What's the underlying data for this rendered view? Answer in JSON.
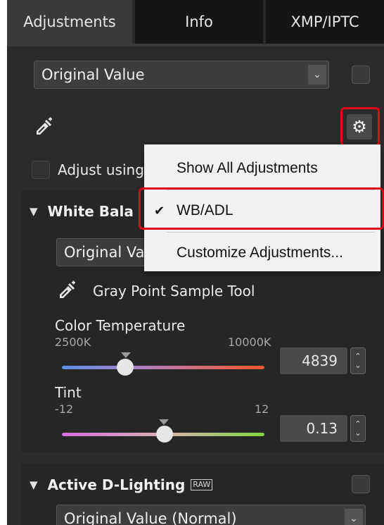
{
  "tabs": [
    {
      "label": "Adjustments",
      "active": true
    },
    {
      "label": "Info",
      "active": false
    },
    {
      "label": "XMP/IPTC",
      "active": false
    }
  ],
  "top": {
    "preset_select": "Original Value",
    "adjust_using_label": "Adjust using"
  },
  "menu": {
    "items": [
      {
        "label": "Show All Adjustments",
        "checked": false
      },
      {
        "label": "WB/ADL",
        "checked": true
      },
      {
        "label": "Customize Adjustments...",
        "checked": false
      }
    ],
    "check_glyph": "✔"
  },
  "white_balance": {
    "title": "White Bala",
    "select": "Original Va",
    "gray_point_tool": "Gray Point Sample Tool",
    "color_temp": {
      "label": "Color Temperature",
      "min_label": "2500K",
      "max_label": "10000K",
      "value": "4839",
      "min": 2500,
      "max": 10000,
      "numeric": 4839
    },
    "tint": {
      "label": "Tint",
      "min_label": "-12",
      "max_label": "12",
      "value": "0.13",
      "min": -12,
      "max": 12,
      "numeric": 0.13
    }
  },
  "active_d_lighting": {
    "title": "Active D-Lighting",
    "badge": "RAW",
    "select": "Original Value (Normal)"
  },
  "icons": {
    "eyedropper": "eyedropper-icon",
    "gear": "gear-icon",
    "triangle": "▼",
    "dropdown": "chevron-down-icon"
  },
  "colors": {
    "highlight_red": "#e0001a",
    "panel_bg": "#2b2b2b",
    "menu_bg": "#f2f2f2"
  }
}
